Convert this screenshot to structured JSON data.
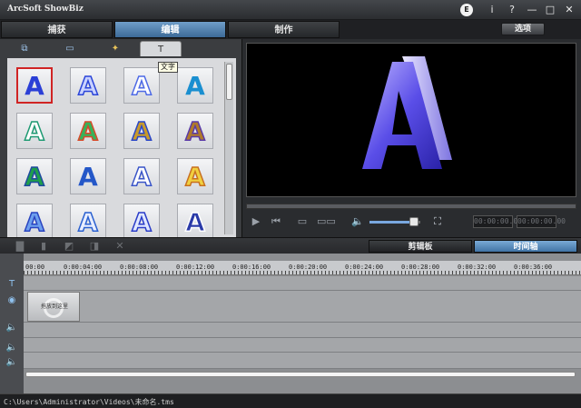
{
  "window": {
    "title": "ArcSoft ShowBiz",
    "controls": {
      "e_badge": "E",
      "info": "i",
      "help": "?",
      "minimize": "—",
      "maximize": "□",
      "close": "✕"
    }
  },
  "main_tabs": [
    {
      "label": "捕获",
      "active": false
    },
    {
      "label": "编辑",
      "active": true
    },
    {
      "label": "制作",
      "active": false
    }
  ],
  "options_button": "选项",
  "media_panel": {
    "subtabs": [
      {
        "icon": "media-library-icon",
        "glyph": "⧉"
      },
      {
        "icon": "film-transition-icon",
        "glyph": "▭"
      },
      {
        "icon": "magic-wand-effects-icon",
        "glyph": "✦"
      },
      {
        "icon": "text-tool-icon",
        "glyph": "T",
        "active": true
      }
    ],
    "tooltip": "文字",
    "text_styles": [
      {
        "letter": "A",
        "style": "blue-gradient",
        "selected": true
      },
      {
        "letter": "A",
        "style": "blue-outline"
      },
      {
        "letter": "A",
        "style": "light-blue-outline"
      },
      {
        "letter": "A",
        "style": "cyan-gradient"
      },
      {
        "letter": "A",
        "style": "green-ring"
      },
      {
        "letter": "A",
        "style": "rainbow"
      },
      {
        "letter": "A",
        "style": "gold-blue"
      },
      {
        "letter": "A",
        "style": "bronze-violet"
      },
      {
        "letter": "A",
        "style": "green-rainbow"
      },
      {
        "letter": "A",
        "style": "blue-solid"
      },
      {
        "letter": "A",
        "style": "white-outline"
      },
      {
        "letter": "A",
        "style": "yellow-glow"
      },
      {
        "letter": "A",
        "style": "blue-light"
      },
      {
        "letter": "A",
        "style": "blue-white"
      },
      {
        "letter": "A",
        "style": "blue-glow"
      },
      {
        "letter": "A",
        "style": "navy-outline"
      }
    ]
  },
  "preview": {
    "letter": "A"
  },
  "player": {
    "timecode_current": "00:00:00.00",
    "timecode_total": "00:00:00.00",
    "volume_fraction": 0.8
  },
  "view_tabs": [
    {
      "label": "剪辑板",
      "active": false
    },
    {
      "label": "时间轴",
      "active": true
    }
  ],
  "timeline": {
    "ruler_ticks": [
      "00:00",
      "0:00:04:00",
      "0:00:08:00",
      "0:00:12:00",
      "0:00:16:00",
      "0:00:20:00",
      "0:00:24:00",
      "0:00:28:00",
      "0:00:32:00",
      "0:00:36:00"
    ],
    "clip_label": "拖放到这里"
  },
  "status": {
    "path": "C:\\Users\\Administrator\\Videos\\未命名.tms"
  }
}
